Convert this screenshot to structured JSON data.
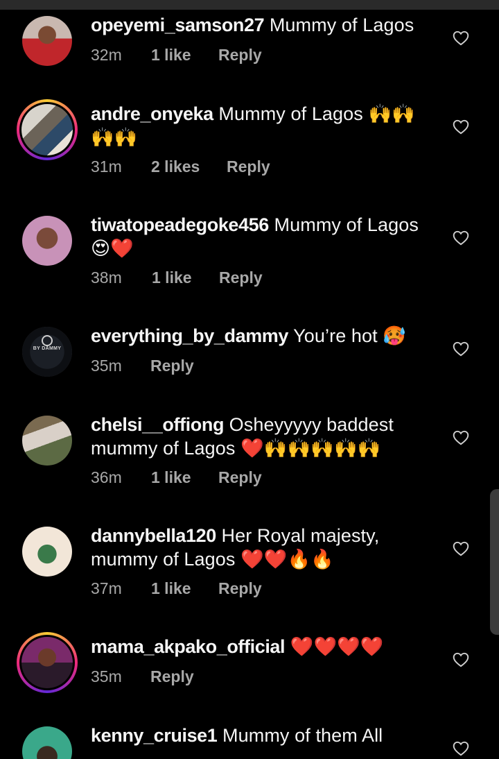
{
  "comments": [
    {
      "username": "opeyemi_samson27",
      "line1": "Mummy of Lagos",
      "line2": "",
      "time": "32m",
      "likes": "1 like",
      "reply": "Reply",
      "avatar": "avatar-red-shirt",
      "story_ring": false
    },
    {
      "username": "andre_onyeka",
      "line1": "Mummy of Lagos 🙌🙌",
      "line2": "🙌🙌",
      "time": "31m",
      "likes": "2 likes",
      "reply": "Reply",
      "avatar": "avatar-room-photo",
      "story_ring": true
    },
    {
      "username": "tiwatopeadegoke456",
      "line1": "Mummy of Lagos",
      "line2": "😍❤️",
      "time": "38m",
      "likes": "1 like",
      "reply": "Reply",
      "avatar": "avatar-pink-selfie",
      "story_ring": false
    },
    {
      "username": "everything_by_dammy",
      "line1": "You’re hot 🥵",
      "line2": "",
      "time": "35m",
      "likes": "",
      "reply": "Reply",
      "avatar": "avatar-logo",
      "logo_text": "BY DAMMY",
      "story_ring": false
    },
    {
      "username": "chelsi__offiong",
      "line1": "Osheyyyyy baddest",
      "line2": "mummy of Lagos ❤️🙌🙌🙌🙌🙌",
      "time": "36m",
      "likes": "1 like",
      "reply": "Reply",
      "avatar": "avatar-outdoor-photo",
      "story_ring": false
    },
    {
      "username": "dannybella120",
      "line1": "Her Royal majesty,",
      "line2": "mummy of Lagos ❤️❤️🔥🔥",
      "time": "37m",
      "likes": "1 like",
      "reply": "Reply",
      "avatar": "avatar-green-dress",
      "story_ring": false
    },
    {
      "username": "mama_akpako_official",
      "line1": "❤️❤️❤️❤️",
      "line2": "",
      "time": "35m",
      "likes": "",
      "reply": "Reply",
      "avatar": "avatar-purple-photo",
      "story_ring": true
    },
    {
      "username": "kenny_cruise1",
      "line1": "Mummy of them All",
      "line2": "",
      "time": "",
      "likes": "",
      "reply": "",
      "avatar": "avatar-teal-photo",
      "story_ring": false
    }
  ],
  "icons": {
    "like": "heart-outline-icon"
  },
  "colors": {
    "background": "#000000",
    "text": "#f5f5f5",
    "meta": "#a8a8a8",
    "heart_outline": "#cfcfcf"
  }
}
